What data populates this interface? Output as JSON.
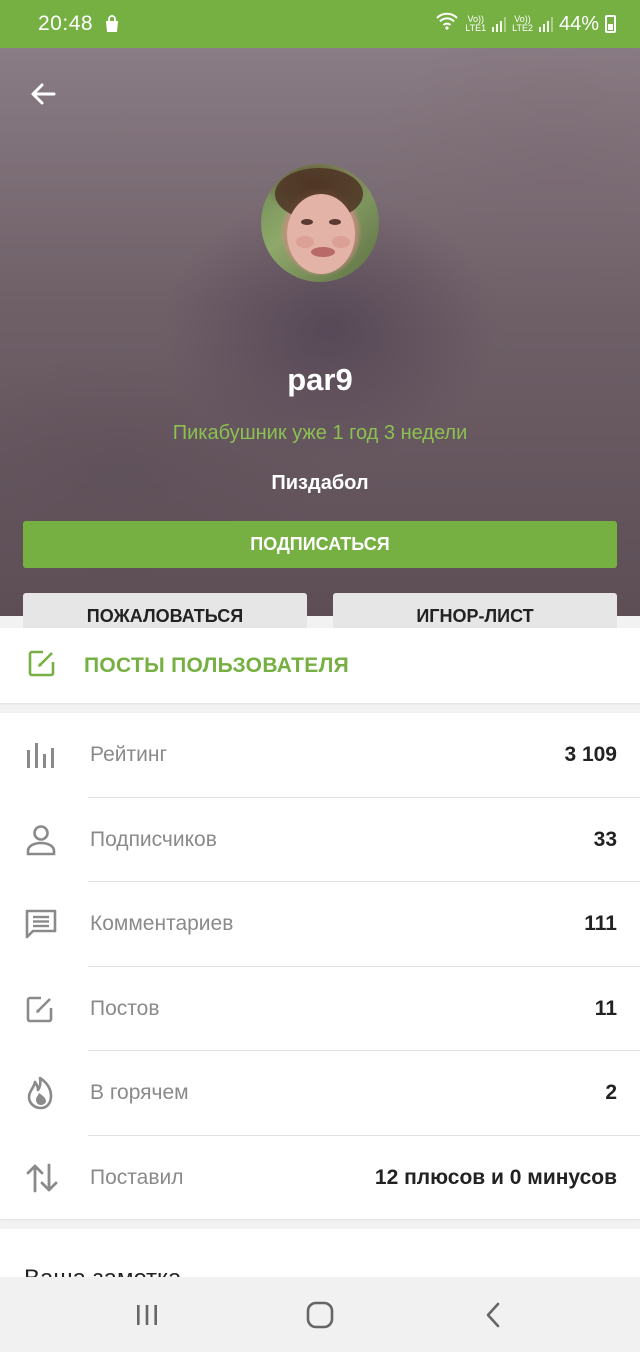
{
  "status_bar": {
    "time": "20:48",
    "sim1": "LTE1",
    "sim2": "LTE2",
    "volte": "Vo))",
    "battery": "44%"
  },
  "profile": {
    "username": "par9",
    "tenure": "Пикабушник уже 1 год 3 недели",
    "rank": "Пиздабол",
    "subscribe_label": "ПОДПИСАТЬСЯ",
    "report_label": "ПОЖАЛОВАТЬСЯ",
    "ignore_label": "ИГНОР-ЛИСТ"
  },
  "posts_link": {
    "label": "ПОСТЫ ПОЛЬЗОВАТЕЛЯ"
  },
  "stats": [
    {
      "label": "Рейтинг",
      "value": "3 109",
      "icon": "bar-chart-icon"
    },
    {
      "label": "Подписчиков",
      "value": "33",
      "icon": "person-icon"
    },
    {
      "label": "Комментариев",
      "value": "111",
      "icon": "comment-icon"
    },
    {
      "label": "Постов",
      "value": "11",
      "icon": "edit-icon"
    },
    {
      "label": "В горячем",
      "value": "2",
      "icon": "flame-icon"
    },
    {
      "label": "Поставил",
      "value": "12 плюсов и 0 минусов",
      "icon": "sort-arrows-icon"
    }
  ],
  "note": {
    "title": "Ваша заметка"
  },
  "colors": {
    "accent": "#76b043",
    "accent_text": "#8cc152"
  }
}
